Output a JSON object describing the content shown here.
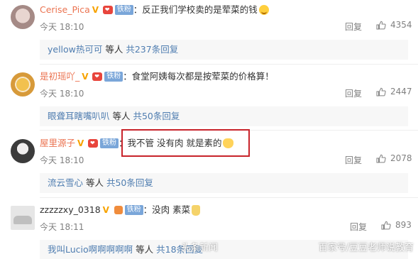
{
  "comments": [
    {
      "username": "Cerise_Pica",
      "fan_badge": "铁粉",
      "text": "：反正我们学校卖的是荤菜的钱",
      "time": "今天 18:10",
      "reply_label": "回复",
      "likes": "4354",
      "sub_user": "yellow热可可",
      "sub_middle": " 等人 ",
      "sub_count": "共237条回复"
    },
    {
      "username": "是初瑶吖_",
      "fan_badge": "铁粉",
      "text": "：食堂阿姨每次都是按荤菜的价格算！",
      "time": "今天 18:10",
      "reply_label": "回复",
      "likes": "2447",
      "sub_user": "眼聋耳瞎嘴叭叭",
      "sub_middle": " 等人 ",
      "sub_count": "共50条回复"
    },
    {
      "username": "屋里源子",
      "fan_badge": "铁粉",
      "text": "：我不管 没有肉 就是素的",
      "time": "今天 18:10",
      "reply_label": "回复",
      "likes": "2078",
      "sub_user": "流云雪心",
      "sub_middle": " 等人 ",
      "sub_count": "共50条回复"
    },
    {
      "username": "zzzzzxy_0318",
      "fan_badge": "铁粉",
      "text": "：没肉 素菜",
      "time": "今天 18:11",
      "reply_label": "回复",
      "likes": "893",
      "sub_user": "我叫Lucio啊啊啊啊啊",
      "sub_middle": " 等人 ",
      "sub_count": "共18条回复"
    }
  ],
  "watermark": {
    "left": "头条新闻",
    "right": "百家号/豆豆老师说教育"
  },
  "colors": {
    "username": "#eb7350",
    "link": "#4f7db0",
    "highlight_border": "#c8242b"
  }
}
